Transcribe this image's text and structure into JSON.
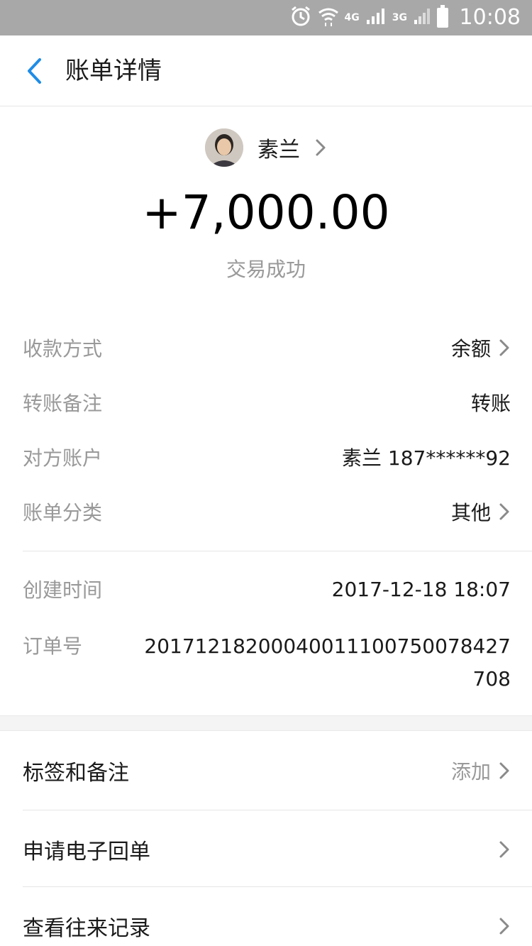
{
  "status_bar": {
    "time": "10:08",
    "network_4g_label": "4G",
    "network_3g_label": "3G",
    "icons": [
      "alarm-icon",
      "wifi-icon",
      "4g-signal-icon",
      "3g-signal-icon",
      "battery-icon"
    ]
  },
  "nav": {
    "title": "账单详情",
    "back_icon": "chevron-left-icon",
    "accent_color": "#1f8ce6"
  },
  "payee": {
    "name": "素兰",
    "amount": "+7,000.00",
    "status": "交易成功"
  },
  "details": [
    {
      "label": "收款方式",
      "value": "余额",
      "has_chevron": true
    },
    {
      "label": "转账备注",
      "value": "转账",
      "has_chevron": false
    },
    {
      "label": "对方账户",
      "value": "素兰 187******92",
      "has_chevron": false
    },
    {
      "label": "账单分类",
      "value": "其他",
      "has_chevron": true
    }
  ],
  "meta": {
    "created_label": "创建时间",
    "created_value": "2017-12-18 18:07",
    "order_label": "订单号",
    "order_value": "20171218200040011100750078427708"
  },
  "menu": [
    {
      "label": "标签和备注",
      "value": "添加"
    },
    {
      "label": "申请电子回单",
      "value": ""
    },
    {
      "label": "查看往来记录",
      "value": ""
    }
  ]
}
